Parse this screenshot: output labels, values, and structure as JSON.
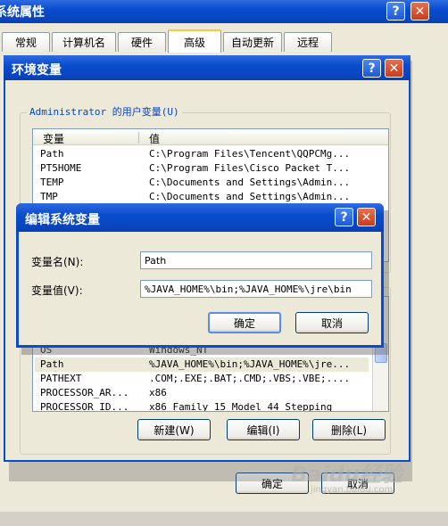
{
  "sys_props": {
    "title": "系统属性",
    "tabs": [
      "常规",
      "计算机名",
      "硬件",
      "高级",
      "自动更新",
      "远程"
    ],
    "ok_label": "确定",
    "cancel_label": "取消"
  },
  "env_vars": {
    "title": "环境变量",
    "user_group_label": "Administrator 的用户变量(U)",
    "col_var": "变量",
    "col_val": "值",
    "user_rows": [
      {
        "name": "Path",
        "value": "C:\\Program Files\\Tencent\\QQPCMg..."
      },
      {
        "name": "PT5HOME",
        "value": "C:\\Program Files\\Cisco Packet T..."
      },
      {
        "name": "TEMP",
        "value": "C:\\Documents and Settings\\Admin..."
      },
      {
        "name": "TMP",
        "value": "C:\\Documents and Settings\\Admin..."
      }
    ],
    "sys_rows": [
      {
        "name": "OS",
        "value": "Windows_NT"
      },
      {
        "name": "Path",
        "value": "%JAVA_HOME%\\bin;%JAVA_HOME%\\jre..."
      },
      {
        "name": "PATHEXT",
        "value": ".COM;.EXE;.BAT;.CMD;.VBS;.VBE;...."
      },
      {
        "name": "PROCESSOR_AR...",
        "value": "x86"
      },
      {
        "name": "PROCESSOR_ID...",
        "value": "x86 Family 15 Model 44 Stepping"
      }
    ],
    "new_label": "新建(W)",
    "edit_label": "编辑(I)",
    "delete_label": "删除(L)"
  },
  "edit_dialog": {
    "title": "编辑系统变量",
    "name_label": "变量名(N):",
    "name_value": "Path",
    "value_label": "变量值(V):",
    "value_value": "%JAVA_HOME%\\bin;%JAVA_HOME%\\jre\\bin",
    "ok_label": "确定",
    "cancel_label": "取消"
  },
  "watermark": {
    "text": "Baidu经验",
    "url": "jingyan.baidu.com"
  }
}
